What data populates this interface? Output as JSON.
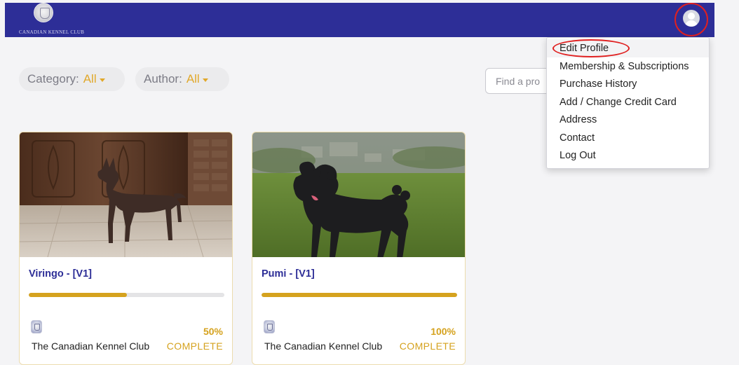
{
  "header": {
    "logo_text": "CANADIAN KENNEL CLUB",
    "colors": {
      "bar": "#2d2e97",
      "accent": "#e1a82a"
    }
  },
  "filters": {
    "category_label": "Category:",
    "category_value": "All",
    "author_label": "Author:",
    "author_value": "All"
  },
  "search": {
    "placeholder": "Find a pro"
  },
  "user_menu": {
    "items": [
      "Edit Profile",
      "Membership & Subscriptions",
      "Purchase History",
      "Add / Change Credit Card",
      "Address",
      "Contact",
      "Log Out"
    ]
  },
  "courses": [
    {
      "title": "Viringo - [V1]",
      "progress": 0.5,
      "percent_label": "50%",
      "owner": "The Canadian Kennel Club",
      "status": "COMPLETE"
    },
    {
      "title": "Pumi - [V1]",
      "progress": 1.0,
      "percent_label": "100%",
      "owner": "The Canadian Kennel Club",
      "status": "COMPLETE"
    }
  ]
}
